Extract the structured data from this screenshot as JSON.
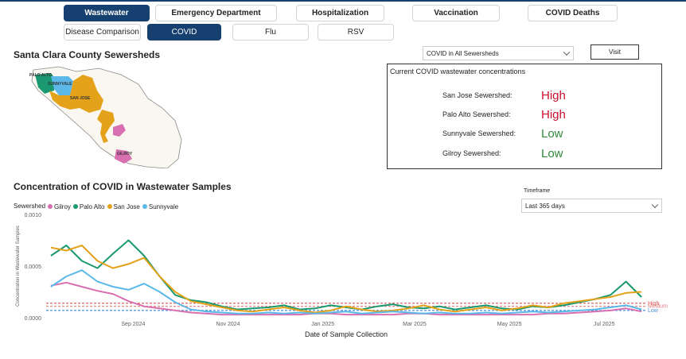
{
  "tabs_primary": [
    {
      "label": "Wastewater",
      "selected": true
    },
    {
      "label": "Emergency Department",
      "selected": false
    },
    {
      "label": "Hospitalization",
      "selected": false
    },
    {
      "label": "Vaccination",
      "selected": false
    },
    {
      "label": "COVID Deaths",
      "selected": false
    }
  ],
  "tabs_secondary": [
    {
      "label": "Disease Comparison",
      "selected": false
    },
    {
      "label": "COVID",
      "selected": true
    },
    {
      "label": "Flu",
      "selected": false
    },
    {
      "label": "RSV",
      "selected": false
    }
  ],
  "map": {
    "title": "Santa Clara County Sewersheds",
    "labels": {
      "palo_alto": "PALO ALTO",
      "sunnyvale": "SUNNYVALE",
      "san_jose": "SAN JOSE",
      "gilroy": "GILROY"
    }
  },
  "sewershed_dropdown": {
    "value": "COVID in All Sewersheds"
  },
  "visit_button": {
    "label": "Visit"
  },
  "current_levels": {
    "title": "Current COVID wastewater concentrations",
    "rows": [
      {
        "label": "San Jose Sewershed:",
        "level": "High",
        "color": "#c8102e"
      },
      {
        "label": "Palo Alto Sewershed:",
        "level": "High",
        "color": "#c8102e"
      },
      {
        "label": "Sunnyvale Sewershed:",
        "level": "Low",
        "color": "#2e8b3a"
      },
      {
        "label": "Gilroy Sewershed:",
        "level": "Low",
        "color": "#2e8b3a"
      }
    ]
  },
  "timeframe": {
    "label": "Timeframe",
    "value": "Last 365 days"
  },
  "chart_data": {
    "type": "line",
    "title": "Concentration of COVID in Wastewater Samples",
    "legend_title": "Sewershed",
    "legend_position": "top-left",
    "xlabel": "Date of Sample Collection",
    "ylabel": "Concentration in Wastewater Samples",
    "ylim": [
      0,
      0.001
    ],
    "yticks": [
      "0.0000",
      "0.0005",
      "0.0010"
    ],
    "xlim": [
      "2024-07-07",
      "2025-07-28"
    ],
    "xticks": [
      {
        "date": "2024-09-01",
        "label": "Sep 2024"
      },
      {
        "date": "2024-11-01",
        "label": "Nov 2024"
      },
      {
        "date": "2025-01-01",
        "label": "Jan 2025"
      },
      {
        "date": "2025-03-01",
        "label": "Mar 2025"
      },
      {
        "date": "2025-05-01",
        "label": "May 2025"
      },
      {
        "date": "2025-07-01",
        "label": "Jul 2025"
      }
    ],
    "thresholds": [
      {
        "name": "High",
        "value": 0.00014,
        "color": "#d9534f"
      },
      {
        "name": "Medium",
        "value": 0.00011,
        "color": "#e07b7b"
      },
      {
        "name": "Low",
        "value": 7e-05,
        "color": "#4a8fd6"
      }
    ],
    "series": [
      {
        "name": "Gilroy",
        "color": "#d86fb0",
        "x": [
          "2024-07-10",
          "2024-07-20",
          "2024-07-30",
          "2024-08-09",
          "2024-08-19",
          "2024-08-29",
          "2024-09-08",
          "2024-09-18",
          "2024-09-28",
          "2024-10-08",
          "2024-10-18",
          "2024-10-28",
          "2024-11-07",
          "2024-11-17",
          "2024-11-27",
          "2024-12-07",
          "2024-12-17",
          "2024-12-27",
          "2025-01-06",
          "2025-01-16",
          "2025-01-26",
          "2025-02-05",
          "2025-02-15",
          "2025-02-25",
          "2025-03-07",
          "2025-03-17",
          "2025-03-27",
          "2025-04-06",
          "2025-04-16",
          "2025-04-26",
          "2025-05-06",
          "2025-05-16",
          "2025-05-26",
          "2025-06-05",
          "2025-06-15",
          "2025-06-25",
          "2025-07-05",
          "2025-07-15",
          "2025-07-25"
        ],
        "y": [
          0.00031,
          0.00034,
          0.0003,
          0.00026,
          0.00023,
          0.00016,
          0.00011,
          9e-05,
          7e-05,
          5e-05,
          4e-05,
          3e-05,
          3e-05,
          3e-05,
          3e-05,
          3e-05,
          3e-05,
          4e-05,
          4e-05,
          3e-05,
          3e-05,
          3e-05,
          3e-05,
          4e-05,
          4e-05,
          3e-05,
          3e-05,
          3e-05,
          3e-05,
          3e-05,
          3e-05,
          3e-05,
          4e-05,
          4e-05,
          5e-05,
          6e-05,
          7e-05,
          9e-05,
          6e-05
        ]
      },
      {
        "name": "Palo Alto",
        "color": "#1a9870",
        "x": [
          "2024-07-10",
          "2024-07-20",
          "2024-07-30",
          "2024-08-09",
          "2024-08-19",
          "2024-08-29",
          "2024-09-08",
          "2024-09-18",
          "2024-09-28",
          "2024-10-08",
          "2024-10-18",
          "2024-10-28",
          "2024-11-07",
          "2024-11-17",
          "2024-11-27",
          "2024-12-07",
          "2024-12-17",
          "2024-12-27",
          "2025-01-06",
          "2025-01-16",
          "2025-01-26",
          "2025-02-05",
          "2025-02-15",
          "2025-02-25",
          "2025-03-07",
          "2025-03-17",
          "2025-03-27",
          "2025-04-06",
          "2025-04-16",
          "2025-04-26",
          "2025-05-06",
          "2025-05-16",
          "2025-05-26",
          "2025-06-05",
          "2025-06-15",
          "2025-06-25",
          "2025-07-05",
          "2025-07-15",
          "2025-07-25"
        ],
        "y": [
          0.0006,
          0.0007,
          0.00055,
          0.00048,
          0.00062,
          0.00075,
          0.0006,
          0.0004,
          0.00022,
          0.00017,
          0.00015,
          0.00011,
          8e-05,
          9e-05,
          0.0001,
          0.00012,
          8e-05,
          9e-05,
          0.00012,
          0.0001,
          8e-05,
          0.00011,
          0.00013,
          0.0001,
          9e-05,
          0.00011,
          8e-05,
          0.0001,
          0.00012,
          9e-05,
          8e-05,
          0.00011,
          0.0001,
          0.00012,
          0.00015,
          0.00018,
          0.00022,
          0.00035,
          0.0002
        ]
      },
      {
        "name": "San Jose",
        "color": "#e3a21a",
        "x": [
          "2024-07-10",
          "2024-07-20",
          "2024-07-30",
          "2024-08-09",
          "2024-08-19",
          "2024-08-29",
          "2024-09-08",
          "2024-09-18",
          "2024-09-28",
          "2024-10-08",
          "2024-10-18",
          "2024-10-28",
          "2024-11-07",
          "2024-11-17",
          "2024-11-27",
          "2024-12-07",
          "2024-12-17",
          "2024-12-27",
          "2025-01-06",
          "2025-01-16",
          "2025-01-26",
          "2025-02-05",
          "2025-02-15",
          "2025-02-25",
          "2025-03-07",
          "2025-03-17",
          "2025-03-27",
          "2025-04-06",
          "2025-04-16",
          "2025-04-26",
          "2025-05-06",
          "2025-05-16",
          "2025-05-26",
          "2025-06-05",
          "2025-06-15",
          "2025-06-25",
          "2025-07-05",
          "2025-07-15",
          "2025-07-25"
        ],
        "y": [
          0.00068,
          0.00065,
          0.0007,
          0.00055,
          0.00048,
          0.00052,
          0.00058,
          0.0004,
          0.00025,
          0.00016,
          0.00013,
          0.0001,
          7e-05,
          6e-05,
          8e-05,
          0.0001,
          7e-05,
          5e-05,
          7e-05,
          0.00011,
          8e-05,
          6e-05,
          7e-05,
          9e-05,
          0.00012,
          8e-05,
          6e-05,
          8e-05,
          0.0001,
          7e-05,
          9e-05,
          0.00012,
          0.0001,
          0.00014,
          0.00016,
          0.00018,
          0.0002,
          0.00024,
          0.00025
        ]
      },
      {
        "name": "Sunnyvale",
        "color": "#5bb8e8",
        "x": [
          "2024-07-10",
          "2024-07-20",
          "2024-07-30",
          "2024-08-09",
          "2024-08-19",
          "2024-08-29",
          "2024-09-08",
          "2024-09-18",
          "2024-09-28",
          "2024-10-08",
          "2024-10-18",
          "2024-10-28",
          "2024-11-07",
          "2024-11-17",
          "2024-11-27",
          "2024-12-07",
          "2024-12-17",
          "2024-12-27",
          "2025-01-06",
          "2025-01-16",
          "2025-01-26",
          "2025-02-05",
          "2025-02-15",
          "2025-02-25",
          "2025-03-07",
          "2025-03-17",
          "2025-03-27",
          "2025-04-06",
          "2025-04-16",
          "2025-04-26",
          "2025-05-06",
          "2025-05-16",
          "2025-05-26",
          "2025-06-05",
          "2025-06-15",
          "2025-06-25",
          "2025-07-05",
          "2025-07-15",
          "2025-07-25"
        ],
        "y": [
          0.0003,
          0.0004,
          0.00046,
          0.00035,
          0.0003,
          0.00027,
          0.00033,
          0.00025,
          0.00015,
          8e-05,
          6e-05,
          5e-05,
          4e-05,
          4e-05,
          5e-05,
          4e-05,
          5e-05,
          4e-05,
          5e-05,
          6e-05,
          4e-05,
          5e-05,
          6e-05,
          5e-05,
          4e-05,
          5e-05,
          4e-05,
          4e-05,
          5e-05,
          4e-05,
          5e-05,
          6e-05,
          5e-05,
          6e-05,
          7e-05,
          8e-05,
          0.0001,
          0.00012,
          8e-05
        ]
      }
    ]
  }
}
